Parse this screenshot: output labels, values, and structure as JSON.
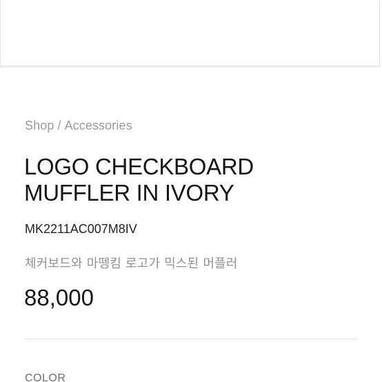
{
  "breadcrumb": {
    "shop": "Shop",
    "separator": "/",
    "category": "Accessories"
  },
  "product": {
    "title_line1": "LOGO CHECKBOARD",
    "title_line2": "MUFFLER IN IVORY",
    "code": "MK2211AC007M8IV",
    "description": "체커보드와 마뗑킴 로고가 믹스된 머플러",
    "price": "88,000"
  },
  "options": {
    "color_label": "COLOR"
  }
}
